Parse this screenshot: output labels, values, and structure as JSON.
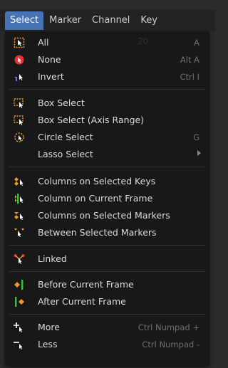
{
  "menubar": {
    "tabs": [
      "Select",
      "Marker",
      "Channel",
      "Key"
    ]
  },
  "menu": {
    "all": {
      "label": "All",
      "shortcut": "A"
    },
    "none": {
      "label": "None",
      "shortcut": "Alt A"
    },
    "invert": {
      "label": "Invert",
      "shortcut": "Ctrl I"
    },
    "box_select": {
      "label": "Box Select"
    },
    "box_select_axis": {
      "label": "Box Select (Axis Range)"
    },
    "circle_select": {
      "label": "Circle Select",
      "shortcut": "G"
    },
    "lasso_select": {
      "label": "Lasso Select"
    },
    "columns_selected_keys": {
      "label": "Columns on Selected Keys"
    },
    "column_current_frame": {
      "label": "Column on Current Frame"
    },
    "columns_selected_markers": {
      "label": "Columns on Selected Markers"
    },
    "between_selected_markers": {
      "label": "Between Selected Markers"
    },
    "linked": {
      "label": "Linked"
    },
    "before_current_frame": {
      "label": "Before Current Frame"
    },
    "after_current_frame": {
      "label": "After Current Frame"
    },
    "more": {
      "label": "More",
      "shortcut": "Ctrl Numpad +"
    },
    "less": {
      "label": "Less",
      "shortcut": "Ctrl Numpad -"
    }
  },
  "background": {
    "frame_number": "20"
  },
  "colors": {
    "accent": "#4772b3",
    "icon_orange": "#e89a2c",
    "icon_green": "#3ec23e",
    "icon_red": "#e2333a",
    "icon_blue": "#4a7fd6"
  }
}
